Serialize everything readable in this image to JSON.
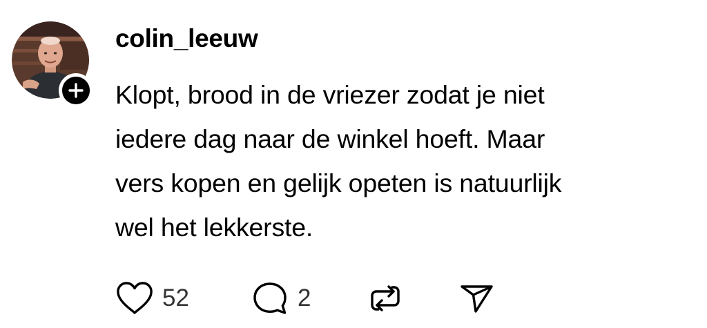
{
  "post": {
    "username": "colin_leeuw",
    "text_lines": [
      "Klopt, brood in de vriezer zodat je niet",
      "iedere dag naar de winkel hoeft. Maar",
      "vers kopen en gelijk opeten is natuurlijk",
      "wel het lekkerste."
    ],
    "avatar_icon": "user-photo",
    "follow_icon": "plus-icon"
  },
  "actions": {
    "like_count": "52",
    "reply_count": "2",
    "like_icon": "heart-icon",
    "reply_icon": "speech-bubble-icon",
    "repost_icon": "repost-icon",
    "share_icon": "send-icon"
  },
  "colors": {
    "text": "#000000",
    "count_text": "#333333",
    "badge": "#000000",
    "background": "#ffffff"
  }
}
